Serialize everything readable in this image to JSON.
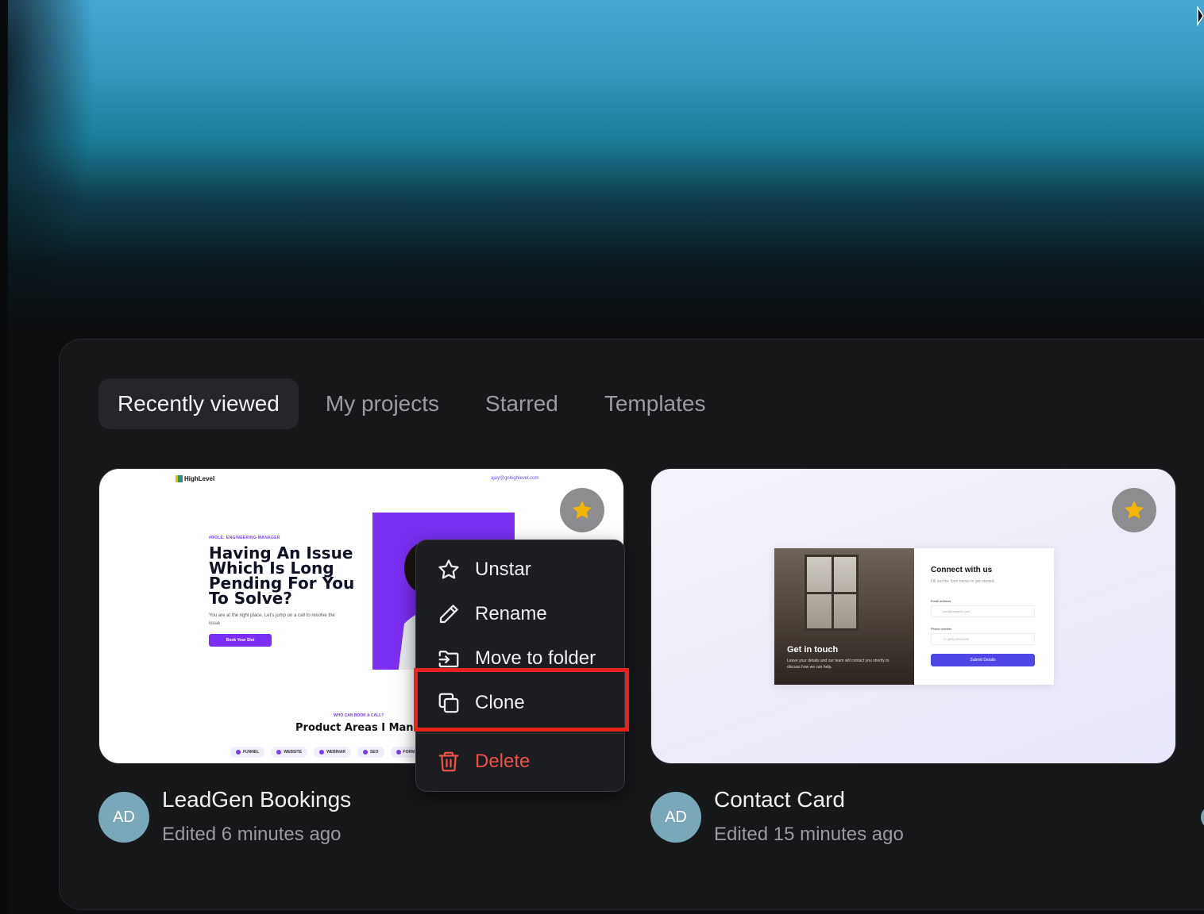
{
  "tabs": [
    {
      "label": "Recently viewed",
      "active": true
    },
    {
      "label": "My projects",
      "active": false
    },
    {
      "label": "Starred",
      "active": false
    },
    {
      "label": "Templates",
      "active": false
    }
  ],
  "projects": [
    {
      "title": "LeadGen Bookings",
      "edited": "Edited 6 minutes ago",
      "avatar": "AD",
      "starred": true,
      "preview": {
        "logo": "HighLevel",
        "email": "ajay@gohighlevel.com",
        "role": "#ROLE: ENGINEERING MANAGER",
        "headline": "Having An Issue Which Is Long Pending For You To Solve?",
        "sub": "You are at the right place. Let's jump on a call to resolve the issue",
        "cta": "Book Your Slot",
        "who": "WHO CAN BOOK A CALL?",
        "areas": "Product Areas I Mana",
        "chips": [
          "FUNNEL",
          "WEBSITE",
          "WEBINAR",
          "SEO",
          "FORM"
        ]
      }
    },
    {
      "title": "Contact Card",
      "edited": "Edited 15 minutes ago",
      "avatar": "AD",
      "starred": true,
      "preview": {
        "img_title": "Get in touch",
        "img_text": "Leave your details and our team will contact you shortly to discuss how we can help.",
        "title": "Connect with us",
        "sub": "Fill out the form below to get started.",
        "email_label": "Email address",
        "email_placeholder": "you@example.com",
        "phone_label": "Phone number",
        "phone_placeholder": "+1 (555) 000-0000",
        "submit": "Submit Details"
      }
    }
  ],
  "context_menu": {
    "items": [
      {
        "label": "Unstar",
        "icon": "star-outline-icon"
      },
      {
        "label": "Rename",
        "icon": "pencil-icon"
      },
      {
        "label": "Move to folder",
        "icon": "folder-move-icon"
      },
      {
        "label": "Clone",
        "icon": "copy-icon",
        "highlighted": true
      },
      {
        "label": "Delete",
        "icon": "trash-icon",
        "danger": true
      }
    ]
  },
  "colors": {
    "accent_star": "#f5b400",
    "danger": "#f0504a",
    "highlight": "#e8231f",
    "avatar": "#79a9b8"
  }
}
